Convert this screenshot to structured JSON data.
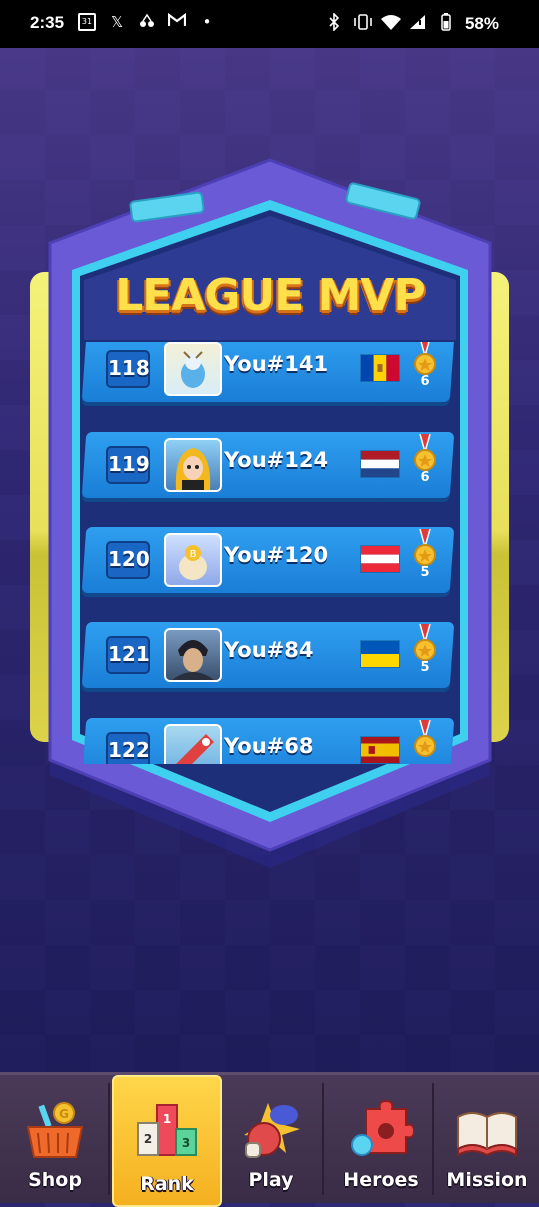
{
  "status_bar": {
    "time": "2:35",
    "calendar_day": "31",
    "battery_percent": "58%",
    "left_icons": [
      "calendar-icon",
      "x-icon",
      "cherry-icon",
      "gmail-icon",
      "dot-icon"
    ],
    "right_icons": [
      "bluetooth-icon",
      "vibrate-icon",
      "wifi-icon",
      "signal-icon",
      "battery-icon"
    ]
  },
  "panel": {
    "title": "LEAGUE MVP"
  },
  "rows": [
    {
      "rank": "118",
      "name": "You#141",
      "flag": "moldova",
      "medals": "6"
    },
    {
      "rank": "119",
      "name": "You#124",
      "flag": "netherlands",
      "medals": "6"
    },
    {
      "rank": "120",
      "name": "You#120",
      "flag": "austria",
      "medals": "5"
    },
    {
      "rank": "121",
      "name": "You#84",
      "flag": "ukraine",
      "medals": "5"
    },
    {
      "rank": "122",
      "name": "You#68",
      "flag": "spain",
      "medals": ""
    }
  ],
  "nav": {
    "items": [
      {
        "label": "Shop",
        "icon": "shop-basket-icon"
      },
      {
        "label": "Rank",
        "icon": "podium-icon",
        "active": true
      },
      {
        "label": "Play",
        "icon": "boxing-glove-icon"
      },
      {
        "label": "Heroes",
        "icon": "puzzle-piece-icon"
      },
      {
        "label": "Mission",
        "icon": "book-icon"
      }
    ]
  },
  "colors": {
    "accent_yellow": "#ffd64a",
    "row_blue": "#1a7ed6",
    "panel_purple": "#6a5ad6",
    "panel_border": "#3fd0f0"
  }
}
